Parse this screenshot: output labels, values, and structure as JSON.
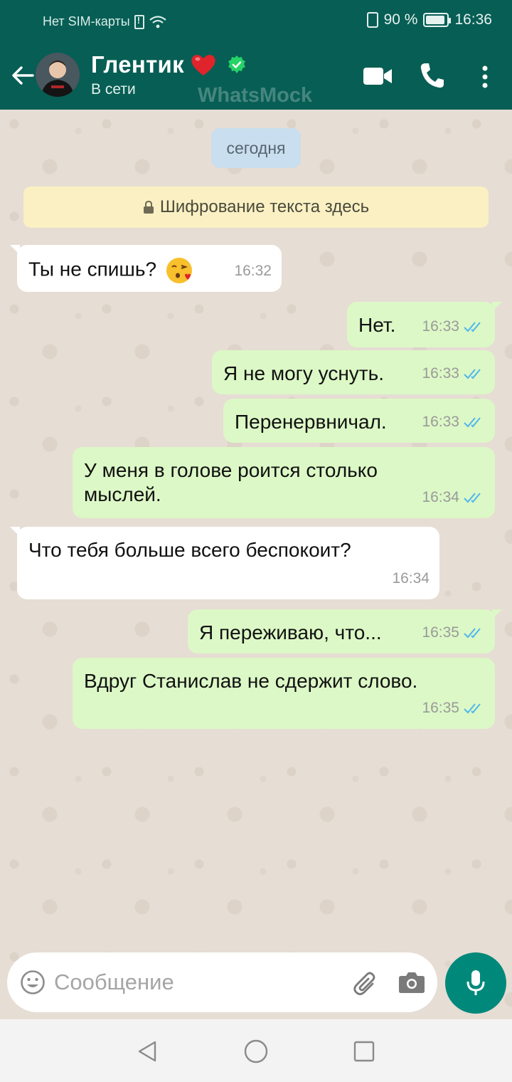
{
  "status_bar": {
    "carrier": "Нет SIM-карты",
    "battery": "90 %",
    "time": "16:36"
  },
  "header": {
    "contact_name": "Глентик",
    "contact_status": "В сети",
    "watermark": "WhatsMock",
    "icons": [
      "back-arrow-icon",
      "video-call-icon",
      "phone-call-icon",
      "more-vert-icon",
      "heart-icon",
      "verified-icon"
    ]
  },
  "chat": {
    "date_chip": "сегодня",
    "encryption_banner": "Шифрование текста здесь",
    "messages": [
      {
        "direction": "in",
        "text": "Ты не спишь?",
        "time": "16:32",
        "emoji": "kissing-face-icon"
      },
      {
        "direction": "out",
        "text": "Нет.",
        "time": "16:33",
        "read": true
      },
      {
        "direction": "out",
        "text": "Я не могу уснуть.",
        "time": "16:33",
        "read": true
      },
      {
        "direction": "out",
        "text": "Перенервничал.",
        "time": "16:33",
        "read": true
      },
      {
        "direction": "out",
        "text": "У меня в голове роится столько мыслей.",
        "time": "16:34",
        "read": true
      },
      {
        "direction": "in",
        "text": "Что тебя больше всего беспокоит?",
        "time": "16:34"
      },
      {
        "direction": "out",
        "text": "Я переживаю, что...",
        "time": "16:35",
        "read": true
      },
      {
        "direction": "out",
        "text": "Вдруг Станислав не сдержит слово.",
        "time": "16:35",
        "read": true
      }
    ]
  },
  "composer": {
    "placeholder": "Сообщение",
    "icons": [
      "emoji-icon",
      "attach-icon",
      "camera-icon",
      "mic-icon"
    ]
  },
  "colors": {
    "header": "#075e54",
    "outgoing_bubble": "#dcf8c6",
    "incoming_bubble": "#ffffff",
    "read_check": "#4fb6ec",
    "mic_button": "#00897b",
    "date_chip": "#c9deee",
    "encryption_banner": "#fbf0c3"
  }
}
